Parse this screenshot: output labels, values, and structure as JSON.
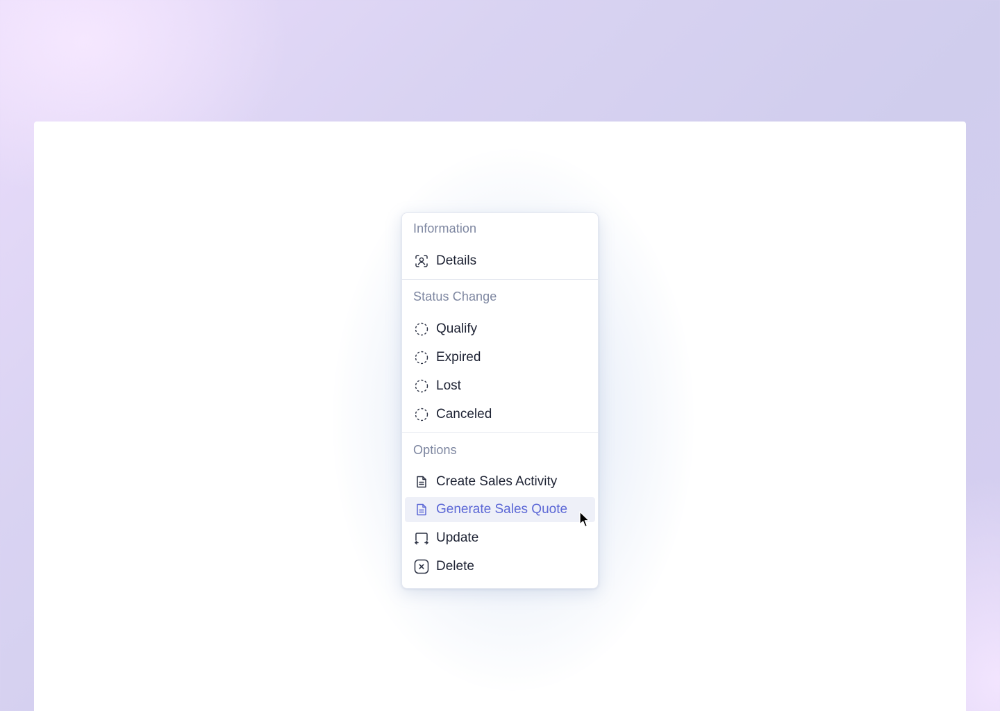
{
  "menu": {
    "sections": {
      "information": {
        "title": "Information",
        "items": [
          {
            "label": "Details",
            "icon": "user-scan-icon"
          }
        ]
      },
      "status_change": {
        "title": "Status Change",
        "items": [
          {
            "label": "Qualify",
            "icon": "dashed-circle-icon"
          },
          {
            "label": "Expired",
            "icon": "dashed-circle-icon"
          },
          {
            "label": "Lost",
            "icon": "dashed-circle-icon"
          },
          {
            "label": "Canceled",
            "icon": "dashed-circle-icon"
          }
        ]
      },
      "options": {
        "title": "Options",
        "items": [
          {
            "label": "Create Sales Activity",
            "icon": "document-icon"
          },
          {
            "label": "Generate Sales Quote",
            "icon": "document-icon",
            "state": "hovered"
          },
          {
            "label": "Update",
            "icon": "update-icon"
          },
          {
            "label": "Delete",
            "icon": "delete-x-icon"
          }
        ]
      }
    }
  },
  "colors": {
    "text": "#1d2233",
    "section_title": "#7d86a0",
    "active_text": "#5c68d6",
    "active_bg": "#eef0f8",
    "icon": "#2a3042"
  }
}
